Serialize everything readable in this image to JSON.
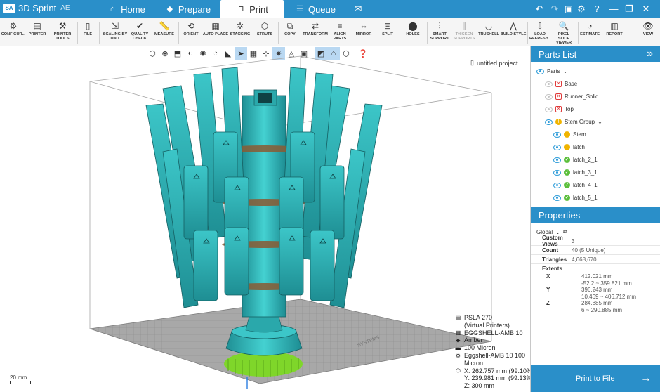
{
  "app": {
    "badge": "SA",
    "name": "3D Sprint",
    "edition": "AE"
  },
  "tabs": [
    {
      "label": "Home",
      "icon": "⌂"
    },
    {
      "label": "Prepare",
      "icon": "◆"
    },
    {
      "label": "Print",
      "icon": "⊓"
    },
    {
      "label": "Queue",
      "icon": "☰"
    }
  ],
  "window_controls": {
    "undo": "↶",
    "redo": "↷",
    "save": "▣",
    "settings": "⚙",
    "help": "?",
    "minimize": "—",
    "maximize": "❐",
    "close": "✕",
    "mail": "✉"
  },
  "toolbar": [
    {
      "label": "CONFIGUR...",
      "icon": "⚙"
    },
    {
      "label": "PRINTER",
      "icon": "▤"
    },
    {
      "label": "PRINTER TOOLS",
      "icon": "⚒",
      "dropdown": true
    },
    {
      "label": "FILE",
      "icon": "▯",
      "dropdown": true
    },
    {
      "label": "SCALING BY UNIT",
      "icon": "⇲"
    },
    {
      "label": "QUALITY CHECK",
      "icon": "✔"
    },
    {
      "label": "MEASURE",
      "icon": "📏"
    },
    {
      "label": "ORIENT",
      "icon": "⟲"
    },
    {
      "label": "AUTO PLACE",
      "icon": "▦"
    },
    {
      "label": "STACKING",
      "icon": "✲",
      "dropdown": true
    },
    {
      "label": "STRUTS",
      "icon": "⬡"
    },
    {
      "label": "COPY",
      "icon": "⧉"
    },
    {
      "label": "TRANSFORM",
      "icon": "⇄"
    },
    {
      "label": "ALIGN PARTS",
      "icon": "≡"
    },
    {
      "label": "MIRROR",
      "icon": "⇔"
    },
    {
      "label": "SPLIT",
      "icon": "⊟"
    },
    {
      "label": "HOLES",
      "icon": "⬤"
    },
    {
      "label": "SMART SUPPORT",
      "icon": "⫶"
    },
    {
      "label": "THICKEN SUPPORTS",
      "icon": "⫼",
      "disabled": true
    },
    {
      "label": "TRUSHELL",
      "icon": "◡"
    },
    {
      "label": "BUILD STYLE",
      "icon": "⋀"
    },
    {
      "label": "LOAD REFRESH...",
      "icon": "⇩"
    },
    {
      "label": "PIXEL SLICE VIEWER",
      "icon": "🔍"
    },
    {
      "label": "ESTIMATE",
      "icon": "◔"
    },
    {
      "label": "REPORT",
      "icon": "▥"
    },
    {
      "label": "VIEW",
      "icon": "👁",
      "dropdown": true
    }
  ],
  "view_tools": [
    "cube-view",
    "zoom",
    "zoom-fit",
    "shade",
    "render",
    "section",
    "select",
    "grid",
    "move",
    "light",
    "layers",
    "ghost",
    "transparent",
    "wire",
    "help"
  ],
  "project": {
    "name": "untitled project",
    "icon": "▯"
  },
  "printer_info": [
    {
      "icon": "▤",
      "text": "PSLA 270"
    },
    {
      "icon": "",
      "text": "(Virtual Printers)"
    },
    {
      "icon": "▦",
      "text": "EGGSHELL-AMB 10"
    },
    {
      "icon": "◆",
      "text": "Amber"
    },
    {
      "icon": "▬",
      "text": "100 Micron"
    },
    {
      "icon": "⚙",
      "text": "Eggshell-AMB 10 100"
    },
    {
      "icon": "",
      "text": "Micron"
    },
    {
      "icon": "⬡",
      "text": "X:  262.757 mm (99.10%)"
    },
    {
      "icon": "",
      "text": "Y:  239.981 mm (99.13%)"
    },
    {
      "icon": "",
      "text": "Z:  300 mm"
    }
  ],
  "scale_bar": "20 mm",
  "platform_label": "SYSTEMS",
  "parts_list": {
    "title": "Parts List",
    "collapse_icon": "»",
    "items": [
      {
        "label": "Parts",
        "status": "",
        "eye": "on",
        "expander": "⌄"
      },
      {
        "label": "Base",
        "status": "err",
        "eye": "dim"
      },
      {
        "label": "Runner_Solid",
        "status": "err",
        "eye": "dim"
      },
      {
        "label": "Top",
        "status": "err",
        "eye": "dim"
      },
      {
        "label": "Stem Group",
        "status": "warn",
        "eye": "on",
        "expander": "⌄"
      },
      {
        "label": "Stem",
        "status": "warn",
        "eye": "on"
      },
      {
        "label": "latch",
        "status": "warn",
        "eye": "on"
      },
      {
        "label": "latch_2_1",
        "status": "ok",
        "eye": "on"
      },
      {
        "label": "latch_3_1",
        "status": "ok",
        "eye": "on"
      },
      {
        "label": "latch_4_1",
        "status": "ok",
        "eye": "on"
      },
      {
        "label": "latch_5_1",
        "status": "ok",
        "eye": "on"
      }
    ]
  },
  "properties": {
    "title": "Properties",
    "scope": "Global",
    "rows": [
      {
        "key": "Custom Views",
        "value": "3"
      },
      {
        "key": "Count",
        "value": "40 (5 Unique)"
      },
      {
        "key": "Triangles",
        "value": "4,668,670"
      }
    ],
    "extents_label": "Extents",
    "extents": [
      {
        "axis": "X",
        "size": "412.021 mm",
        "range": "-52.2 ~ 359.821 mm"
      },
      {
        "axis": "Y",
        "size": "396.243 mm",
        "range": "10.469 ~ 406.712 mm"
      },
      {
        "axis": "Z",
        "size": "284.885 mm",
        "range": "6 ~ 290.885 mm"
      }
    ]
  },
  "print_button": {
    "label": "Print to File",
    "arrow": "→"
  },
  "colors": {
    "brand": "#2a8fc9",
    "model": "#2fb9b9",
    "support": "#7fd62a",
    "status_ok": "#5cbf3c",
    "status_warn": "#f0b400",
    "status_err": "#e03a3a"
  }
}
